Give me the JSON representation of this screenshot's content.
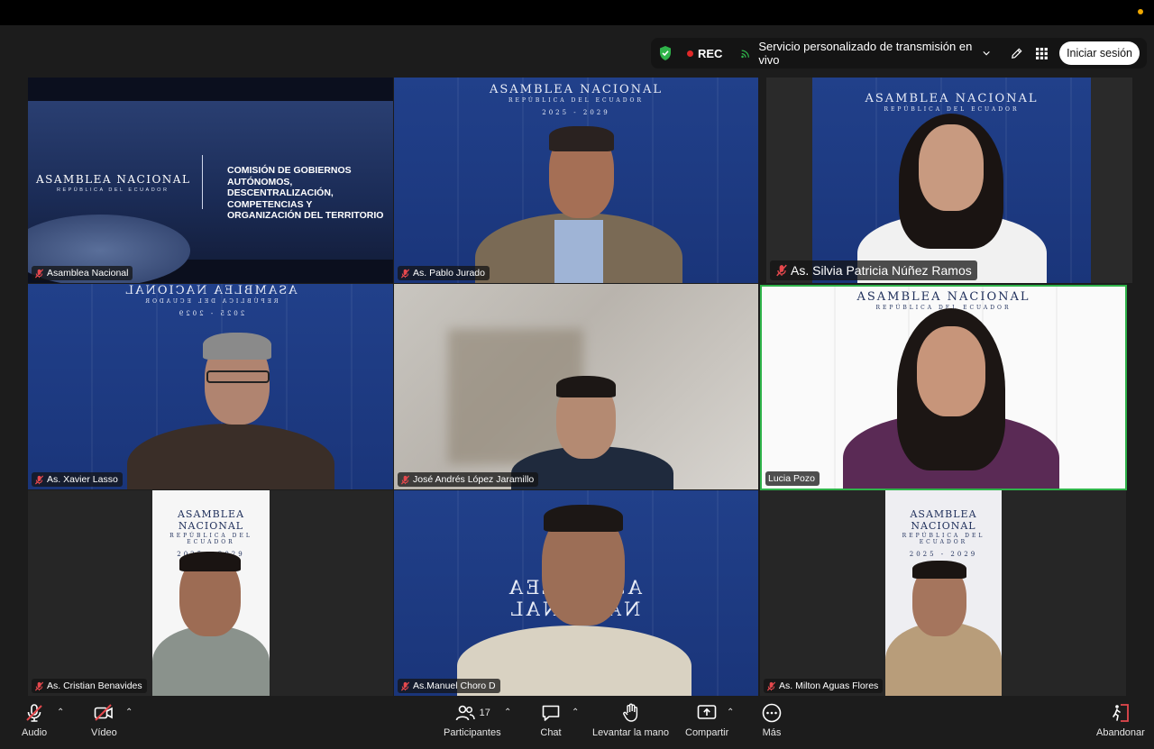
{
  "topbar": {
    "rec_label": "REC",
    "stream_label": "Servicio personalizado de transmisión en vivo",
    "signin_label": "Iniciar sesión"
  },
  "tiles": {
    "t1": {
      "name": "Asamblea Nacional",
      "banner_brand": "ASAMBLEA NACIONAL",
      "banner_sub": "REPÚBLICA DEL ECUADOR",
      "banner_text": "COMISIÓN DE GOBIERNOS AUTÓNOMOS, DESCENTRALIZACIÓN, COMPETENCIAS Y ORGANIZACIÓN DEL TERRITORIO"
    },
    "t2": {
      "name": "As. Pablo Jurado"
    },
    "t3": {
      "name": "As. Silvia Patricia Núñez Ramos"
    },
    "t4": {
      "name": "As. Xavier Lasso"
    },
    "t5": {
      "name": "José Andrés López Jaramillo"
    },
    "t6": {
      "name": "Lucia Pozo"
    },
    "t7": {
      "name": "As. Cristian Benavides"
    },
    "t8": {
      "name": "As.Manuel Choro D"
    },
    "t9": {
      "name": "As. Milton Aguas Flores"
    }
  },
  "backdrop": {
    "title": "ASAMBLEA NACIONAL",
    "subtitle": "REPÚBLICA DEL ECUADOR",
    "years": "2025 - 2029"
  },
  "toolbar": {
    "audio": "Audio",
    "video": "Vídeo",
    "participants": "Participantes",
    "participants_count": "17",
    "chat": "Chat",
    "raise_hand": "Levantar la mano",
    "share": "Compartir",
    "more": "Más",
    "leave": "Abandonar"
  },
  "colors": {
    "accent_green": "#2fb34a",
    "rec_red": "#e02828",
    "leave_red": "#e5484d"
  }
}
